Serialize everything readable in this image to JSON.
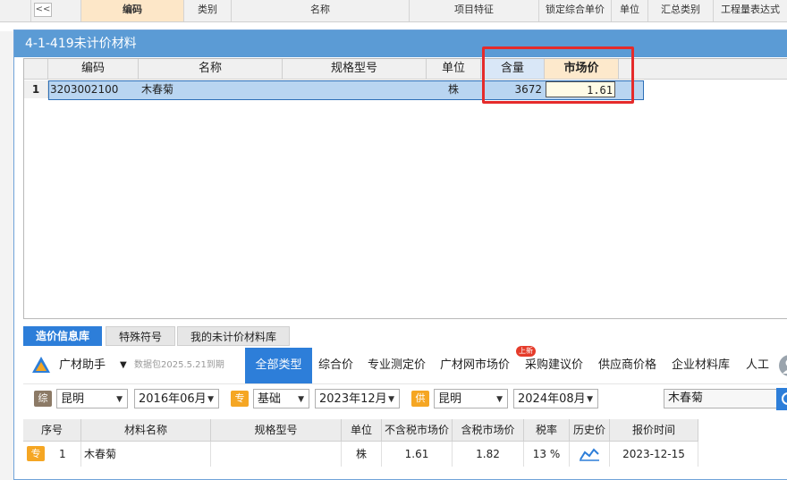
{
  "background_grid": {
    "collapse_label": "<<",
    "headers": [
      "编码",
      "类别",
      "名称",
      "项目特征",
      "锁定综合单价",
      "单位",
      "汇总类别",
      "工程量表达式"
    ]
  },
  "dialog": {
    "title": "4-1-419未计价材料",
    "table": {
      "columns": [
        "编码",
        "名称",
        "规格型号",
        "单位",
        "含量",
        "市场价"
      ],
      "rows": [
        {
          "index": "1",
          "code": "3203002100",
          "name": "木春菊",
          "spec": "",
          "unit": "株",
          "content": "3672",
          "price": "1.61"
        }
      ]
    }
  },
  "bottom": {
    "tabs": [
      "造价信息库",
      "特殊符号",
      "我的未计价材料库"
    ],
    "brand": "广材助手",
    "data_pack": "数据包2025.5.21到期",
    "nav": [
      "全部类型",
      "综合价",
      "专业测定价",
      "广材网市场价",
      "采购建议价",
      "供应商价格",
      "企业材料库",
      "人工"
    ],
    "new_badge": "上新",
    "filters": {
      "tag1": "综",
      "city1": "昆明",
      "period1": "2016年06月",
      "tag2": "专",
      "type2": "基础",
      "period2": "2023年12月",
      "tag3": "供",
      "city3": "昆明",
      "period3": "2024年08月",
      "search_value": "木春菊"
    },
    "results": {
      "columns": [
        "序号",
        "材料名称",
        "规格型号",
        "单位",
        "不含税市场价",
        "含税市场价",
        "税率",
        "历史价",
        "报价时间"
      ],
      "rows": [
        {
          "tag": "专",
          "index": "1",
          "name": "木春菊",
          "spec": "",
          "unit": "株",
          "price_ex_tax": "1.61",
          "price_inc_tax": "1.82",
          "tax_rate": "13 %",
          "date": "2023-12-15"
        }
      ]
    }
  },
  "colors": {
    "accent": "#2d7ed9",
    "title_bar": "#5b9bd5",
    "highlight": "#e52b2b",
    "tag_orange": "#f5a623"
  }
}
